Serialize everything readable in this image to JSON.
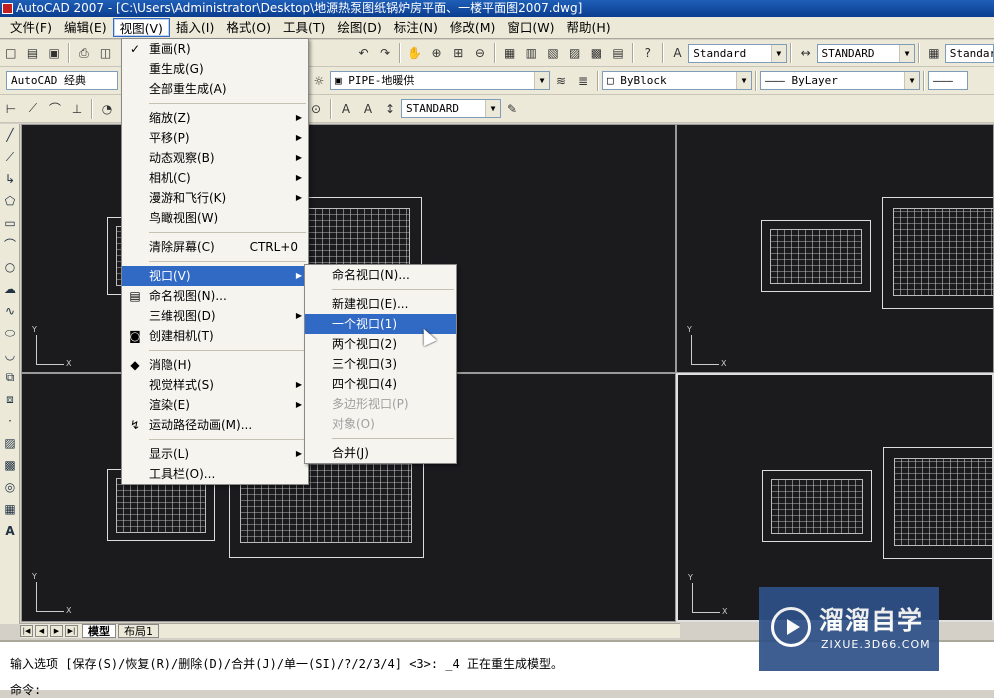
{
  "window": {
    "title": "AutoCAD 2007 - [C:\\Users\\Administrator\\Desktop\\地源热泵图纸锅炉房平面、一楼平面图2007.dwg]"
  },
  "menubar": [
    "文件(F)",
    "编辑(E)",
    "视图(V)",
    "插入(I)",
    "格式(O)",
    "工具(T)",
    "绘图(D)",
    "标注(N)",
    "修改(M)",
    "窗口(W)",
    "帮助(H)"
  ],
  "toolbar": {
    "text_style": "Standard",
    "dim_style": "STANDARD",
    "table_style": "Standard",
    "workspace": "AutoCAD 经典",
    "layer": "PIPE-地暖供",
    "color": "ByBlock",
    "linetype": "ByLayer",
    "dim_style2": "STANDARD"
  },
  "view_menu": {
    "items": [
      {
        "label": "重画(R)",
        "icon": "pencil-check-icon"
      },
      {
        "label": "重生成(G)"
      },
      {
        "label": "全部重生成(A)"
      },
      {
        "sep": true
      },
      {
        "label": "缩放(Z)",
        "submenu": true
      },
      {
        "label": "平移(P)",
        "submenu": true
      },
      {
        "label": "动态观察(B)",
        "submenu": true
      },
      {
        "label": "相机(C)",
        "submenu": true
      },
      {
        "label": "漫游和飞行(K)",
        "submenu": true
      },
      {
        "label": "鸟瞰视图(W)"
      },
      {
        "sep": true
      },
      {
        "label": "清除屏幕(C)",
        "shortcut": "CTRL+0"
      },
      {
        "sep": true
      },
      {
        "label": "视口(V)",
        "submenu": true,
        "highlight": true
      },
      {
        "label": "命名视图(N)...",
        "icon": "named-view-icon"
      },
      {
        "label": "三维视图(D)",
        "submenu": true
      },
      {
        "label": "创建相机(T)",
        "icon": "camera-icon"
      },
      {
        "sep": true
      },
      {
        "label": "消隐(H)",
        "icon": "hide-icon"
      },
      {
        "label": "视觉样式(S)",
        "submenu": true
      },
      {
        "label": "渲染(E)",
        "submenu": true
      },
      {
        "label": "运动路径动画(M)...",
        "icon": "motion-path-icon"
      },
      {
        "sep": true
      },
      {
        "label": "显示(L)",
        "submenu": true
      },
      {
        "label": "工具栏(O)..."
      }
    ]
  },
  "viewport_submenu": {
    "items": [
      {
        "label": "命名视口(N)..."
      },
      {
        "sep": true
      },
      {
        "label": "新建视口(E)..."
      },
      {
        "label": "一个视口(1)",
        "highlight": true
      },
      {
        "label": "两个视口(2)"
      },
      {
        "label": "三个视口(3)"
      },
      {
        "label": "四个视口(4)"
      },
      {
        "label": "多边形视口(P)",
        "disabled": true
      },
      {
        "label": "对象(O)",
        "disabled": true
      },
      {
        "sep": true
      },
      {
        "label": "合并(J)"
      }
    ]
  },
  "tabs": {
    "model": "模型",
    "layout1": "布局1"
  },
  "ucs": {
    "y": "Y",
    "x": "X"
  },
  "command": {
    "line1": "输入选项 [保存(S)/恢复(R)/删除(D)/合并(J)/单一(SI)/?/2/3/4] <3>: _4 正在重生成模型。",
    "line2": "命令:"
  },
  "watermark": {
    "title": "溜溜自学",
    "url": "ZIXUE.3D66.COM"
  }
}
